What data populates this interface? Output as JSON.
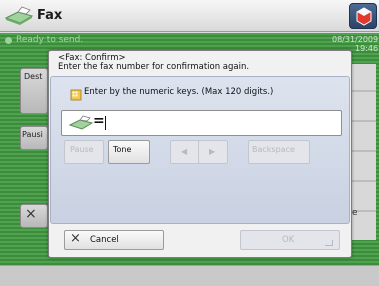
{
  "header": {
    "title": "Fax"
  },
  "status": {
    "text": "Ready to send.",
    "date": "08/31/2009",
    "time": "19:46"
  },
  "background": {
    "dest_label": "Dest",
    "pause_label": "Pausi",
    "close_glyph": "×",
    "side_letter": "e"
  },
  "dialog": {
    "title": "<Fax: Confirm>",
    "prompt": "Enter the fax number for confirmation again.",
    "instruction": "Enter by the numeric keys. (Max 120 digits.)",
    "field_prefix": "=",
    "field_value": "",
    "buttons": {
      "pause": "Pause",
      "tone": "Tone",
      "left_arrow": "◀",
      "right_arrow": "▶",
      "backspace": "Backspace",
      "cancel_glyph": "×",
      "cancel": "Cancel",
      "ok": "OK"
    }
  },
  "colors": {
    "accent_green": "#4fa24f",
    "dialog_panel": "#dde3ee",
    "header_button": "#2b4467"
  },
  "icons": {
    "app": "fax-machine-icon",
    "keys": "numeric-keys-icon",
    "field": "fax-machine-icon",
    "corner": "user-icon"
  }
}
